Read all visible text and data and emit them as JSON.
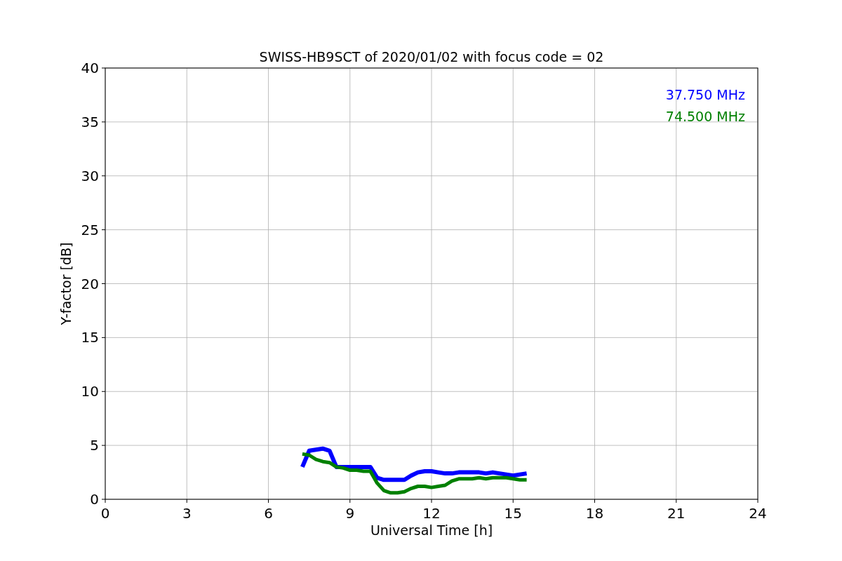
{
  "figure": {
    "chart_data": {
      "type": "line",
      "title": "SWISS-HB9SCT of 2020/01/02 with focus code = 02",
      "xlabel": "Universal Time [h]",
      "ylabel": "Y-factor [dB]",
      "x": [
        7.25,
        7.5,
        7.75,
        8,
        8.25,
        8.5,
        8.75,
        9,
        9.25,
        9.5,
        9.75,
        10,
        10.25,
        10.5,
        10.75,
        11,
        11.25,
        11.5,
        11.75,
        12,
        12.25,
        12.5,
        12.75,
        13,
        13.25,
        13.5,
        13.75,
        14,
        14.25,
        14.5,
        14.75,
        15,
        15.25,
        15.5
      ],
      "series": [
        {
          "name": "37.750 MHz",
          "color": "#0000ff",
          "values": [
            3.0,
            4.5,
            4.6,
            4.7,
            4.5,
            3.0,
            3.0,
            3.0,
            3.0,
            3.0,
            3.0,
            2.0,
            1.8,
            1.8,
            1.8,
            1.8,
            2.2,
            2.5,
            2.6,
            2.6,
            2.5,
            2.4,
            2.4,
            2.5,
            2.5,
            2.5,
            2.5,
            2.4,
            2.5,
            2.4,
            2.3,
            2.2,
            2.3,
            2.4
          ]
        },
        {
          "name": "74.500 MHz",
          "color": "#008000",
          "values": [
            4.2,
            4.1,
            3.7,
            3.5,
            3.4,
            3.0,
            2.9,
            2.7,
            2.7,
            2.6,
            2.6,
            1.5,
            0.8,
            0.6,
            0.6,
            0.7,
            1.0,
            1.2,
            1.2,
            1.1,
            1.2,
            1.3,
            1.7,
            1.9,
            1.9,
            1.9,
            2.0,
            1.9,
            2.0,
            2.0,
            2.0,
            1.9,
            1.8,
            1.8
          ]
        }
      ],
      "xlim": [
        0,
        24
      ],
      "ylim": [
        0,
        40
      ],
      "xticks": [
        0,
        3,
        6,
        9,
        12,
        15,
        18,
        21,
        24
      ],
      "yticks": [
        0,
        5,
        10,
        15,
        20,
        25,
        30,
        35,
        40
      ],
      "grid": true
    }
  }
}
